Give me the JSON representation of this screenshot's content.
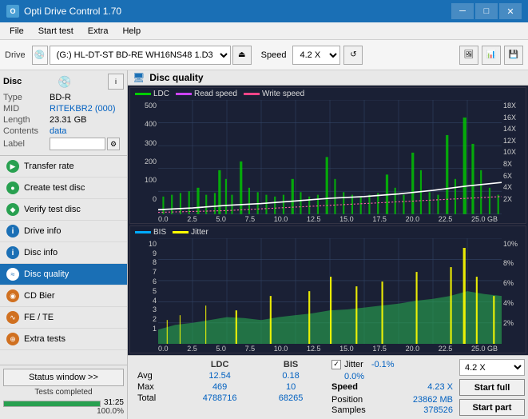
{
  "app": {
    "title": "Opti Drive Control 1.70",
    "icon": "O"
  },
  "titlebar": {
    "minimize": "─",
    "maximize": "□",
    "close": "✕"
  },
  "menu": {
    "items": [
      "File",
      "Start test",
      "Extra",
      "Help"
    ]
  },
  "toolbar": {
    "drive_label": "Drive",
    "drive_value": "(G:) HL-DT-ST BD-RE  WH16NS48 1.D3",
    "speed_label": "Speed",
    "speed_value": "4.2 X"
  },
  "disc": {
    "title": "Disc",
    "type_label": "Type",
    "type_value": "BD-R",
    "mid_label": "MID",
    "mid_value": "RITEKBR2 (000)",
    "length_label": "Length",
    "length_value": "23.31 GB",
    "contents_label": "Contents",
    "contents_value": "data",
    "label_label": "Label"
  },
  "nav": {
    "items": [
      {
        "id": "transfer-rate",
        "label": "Transfer rate",
        "icon": "▶",
        "iconClass": "green"
      },
      {
        "id": "create-test",
        "label": "Create test disc",
        "icon": "●",
        "iconClass": "green"
      },
      {
        "id": "verify-test",
        "label": "Verify test disc",
        "icon": "◆",
        "iconClass": "green"
      },
      {
        "id": "drive-info",
        "label": "Drive info",
        "icon": "i",
        "iconClass": "blue"
      },
      {
        "id": "disc-info",
        "label": "Disc info",
        "icon": "i",
        "iconClass": "blue"
      },
      {
        "id": "disc-quality",
        "label": "Disc quality",
        "icon": "≈",
        "iconClass": "active",
        "active": true
      },
      {
        "id": "cd-bier",
        "label": "CD Bier",
        "icon": "◉",
        "iconClass": "orange"
      },
      {
        "id": "fe-te",
        "label": "FE / TE",
        "icon": "∿",
        "iconClass": "orange"
      },
      {
        "id": "extra-tests",
        "label": "Extra tests",
        "icon": "⊕",
        "iconClass": "orange"
      }
    ]
  },
  "status": {
    "button_label": "Status window >>",
    "text": "Tests completed",
    "progress": 100,
    "progress_text": "100.0%",
    "time": "31:25"
  },
  "disc_quality": {
    "header": "Disc quality",
    "chart1": {
      "legend": [
        {
          "label": "LDC",
          "color": "#00cc00"
        },
        {
          "label": "Read speed",
          "color": "#cc44ff"
        },
        {
          "label": "Write speed",
          "color": "#ff4488"
        }
      ],
      "y_axis_left": [
        "500",
        "400",
        "300",
        "200",
        "100",
        "0"
      ],
      "y_axis_right": [
        "18X",
        "16X",
        "14X",
        "12X",
        "10X",
        "8X",
        "6X",
        "4X",
        "2X"
      ],
      "x_axis": [
        "0.0",
        "2.5",
        "5.0",
        "7.5",
        "10.0",
        "12.5",
        "15.0",
        "17.5",
        "20.0",
        "22.5",
        "25.0 GB"
      ]
    },
    "chart2": {
      "legend": [
        {
          "label": "BIS",
          "color": "#00aaff"
        },
        {
          "label": "Jitter",
          "color": "#ffff00"
        }
      ],
      "y_axis_left": [
        "10",
        "9",
        "8",
        "7",
        "6",
        "5",
        "4",
        "3",
        "2",
        "1"
      ],
      "y_axis_right": [
        "10%",
        "8%",
        "6%",
        "4%",
        "2%"
      ],
      "x_axis": [
        "0.0",
        "2.5",
        "5.0",
        "7.5",
        "10.0",
        "12.5",
        "15.0",
        "17.5",
        "20.0",
        "22.5",
        "25.0 GB"
      ]
    }
  },
  "stats": {
    "columns": [
      "",
      "LDC",
      "BIS",
      "",
      "Jitter",
      "Speed"
    ],
    "avg_label": "Avg",
    "avg_ldc": "12.54",
    "avg_bis": "0.18",
    "avg_jitter": "-0.1%",
    "avg_speed": "4.23 X",
    "max_label": "Max",
    "max_ldc": "469",
    "max_bis": "10",
    "max_jitter": "0.0%",
    "total_label": "Total",
    "total_ldc": "4788716",
    "total_bis": "68265",
    "jitter_checked": true,
    "jitter_label": "Jitter",
    "position_label": "Position",
    "position_value": "23862 MB",
    "samples_label": "Samples",
    "samples_value": "378526",
    "speed_options": [
      "4.2 X"
    ],
    "start_full_label": "Start full",
    "start_part_label": "Start part"
  }
}
